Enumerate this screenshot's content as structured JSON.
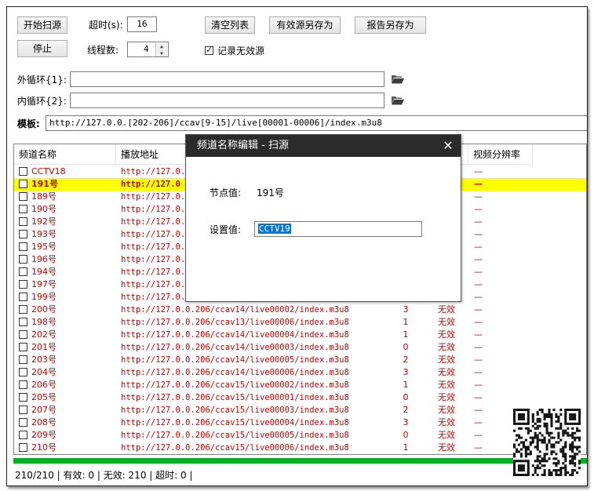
{
  "toolbar": {
    "start_scan": "开始扫源",
    "stop": "停止",
    "timeout_label": "超时(s):",
    "timeout_value": "16",
    "threads_label": "线程数:",
    "threads_value": "4",
    "clear_list": "清空列表",
    "save_valid": "有效源另存为",
    "save_report": "报告另存为",
    "log_invalid_label": "记录无效源"
  },
  "outer_loop": {
    "label": "外循环{1}:",
    "value": ""
  },
  "inner_loop": {
    "label": "内循环{2}:",
    "value": ""
  },
  "template": {
    "label": "模板:",
    "value": "http://127.0.0.[202-206]/ccav[9-15]/live[00001-00006]/index.m3u8"
  },
  "columns": [
    "频道名称",
    "播放地址",
    "",
    "",
    "视频分辨率"
  ],
  "rows_top": [
    {
      "name": "CCTV18",
      "url": "http://127.0.0",
      "res": "—"
    },
    {
      "name": "191号",
      "url": "http://127.0",
      "res": "—",
      "hl": true
    },
    {
      "name": "189号",
      "url": "http://127.0.0",
      "res": "—"
    },
    {
      "name": "190号",
      "url": "http://127.0.0",
      "res": "—"
    },
    {
      "name": "192号",
      "url": "http://127.0.0",
      "res": "—"
    },
    {
      "name": "193号",
      "url": "http://127.0.0",
      "res": "—"
    },
    {
      "name": "195号",
      "url": "http://127.0.0",
      "res": "—"
    },
    {
      "name": "196号",
      "url": "http://127.0.0",
      "res": "—"
    },
    {
      "name": "194号",
      "url": "http://127.0.0",
      "res": "—"
    },
    {
      "name": "197号",
      "url": "http://127.0.0",
      "res": "—"
    },
    {
      "name": "199号",
      "url": "http://127.0.0",
      "res": "—"
    }
  ],
  "rows": [
    {
      "name": "200号",
      "url": "http://127.0.0.206/ccav14/live00002/index.m3u8",
      "count": "3",
      "status": "无效",
      "res": "—"
    },
    {
      "name": "198号",
      "url": "http://127.0.0.206/ccav13/live00006/index.m3u8",
      "count": "1",
      "status": "无效",
      "res": "—"
    },
    {
      "name": "202号",
      "url": "http://127.0.0.206/ccav14/live00004/index.m3u8",
      "count": "1",
      "status": "无效",
      "res": "—"
    },
    {
      "name": "201号",
      "url": "http://127.0.0.206/ccav14/live00003/index.m3u8",
      "count": "0",
      "status": "无效",
      "res": "—"
    },
    {
      "name": "203号",
      "url": "http://127.0.0.206/ccav14/live00005/index.m3u8",
      "count": "2",
      "status": "无效",
      "res": "—"
    },
    {
      "name": "204号",
      "url": "http://127.0.0.206/ccav14/live00006/index.m3u8",
      "count": "3",
      "status": "无效",
      "res": "—"
    },
    {
      "name": "206号",
      "url": "http://127.0.0.206/ccav15/live00002/index.m3u8",
      "count": "1",
      "status": "无效",
      "res": "—"
    },
    {
      "name": "205号",
      "url": "http://127.0.0.206/ccav15/live00001/index.m3u8",
      "count": "0",
      "status": "无效",
      "res": "—"
    },
    {
      "name": "207号",
      "url": "http://127.0.0.206/ccav15/live00003/index.m3u8",
      "count": "2",
      "status": "无效",
      "res": "—"
    },
    {
      "name": "208号",
      "url": "http://127.0.0.206/ccav15/live00004/index.m3u8",
      "count": "3",
      "status": "无效",
      "res": "—"
    },
    {
      "name": "209号",
      "url": "http://127.0.0.206/ccav15/live00005/index.m3u8",
      "count": "0",
      "status": "无效",
      "res": "—"
    },
    {
      "name": "210号",
      "url": "http://127.0.0.206/ccav15/live00006/index.m3u8",
      "count": "1",
      "status": "无效",
      "res": "—"
    }
  ],
  "status_bar": "210/210 | 有效: 0 | 无效: 210 | 超时: 0 |",
  "dialog": {
    "title": "频道名称编辑 - 扫源",
    "node_label": "节点值:",
    "node_value": "191号",
    "set_label": "设置值:",
    "set_value": "CCTV19"
  },
  "colors": {
    "row_text": "#c80000",
    "highlight": "#ffff00",
    "progress": "#06b025",
    "dialog_title_bg": "#2b2b2b",
    "selection": "#0078d7"
  }
}
